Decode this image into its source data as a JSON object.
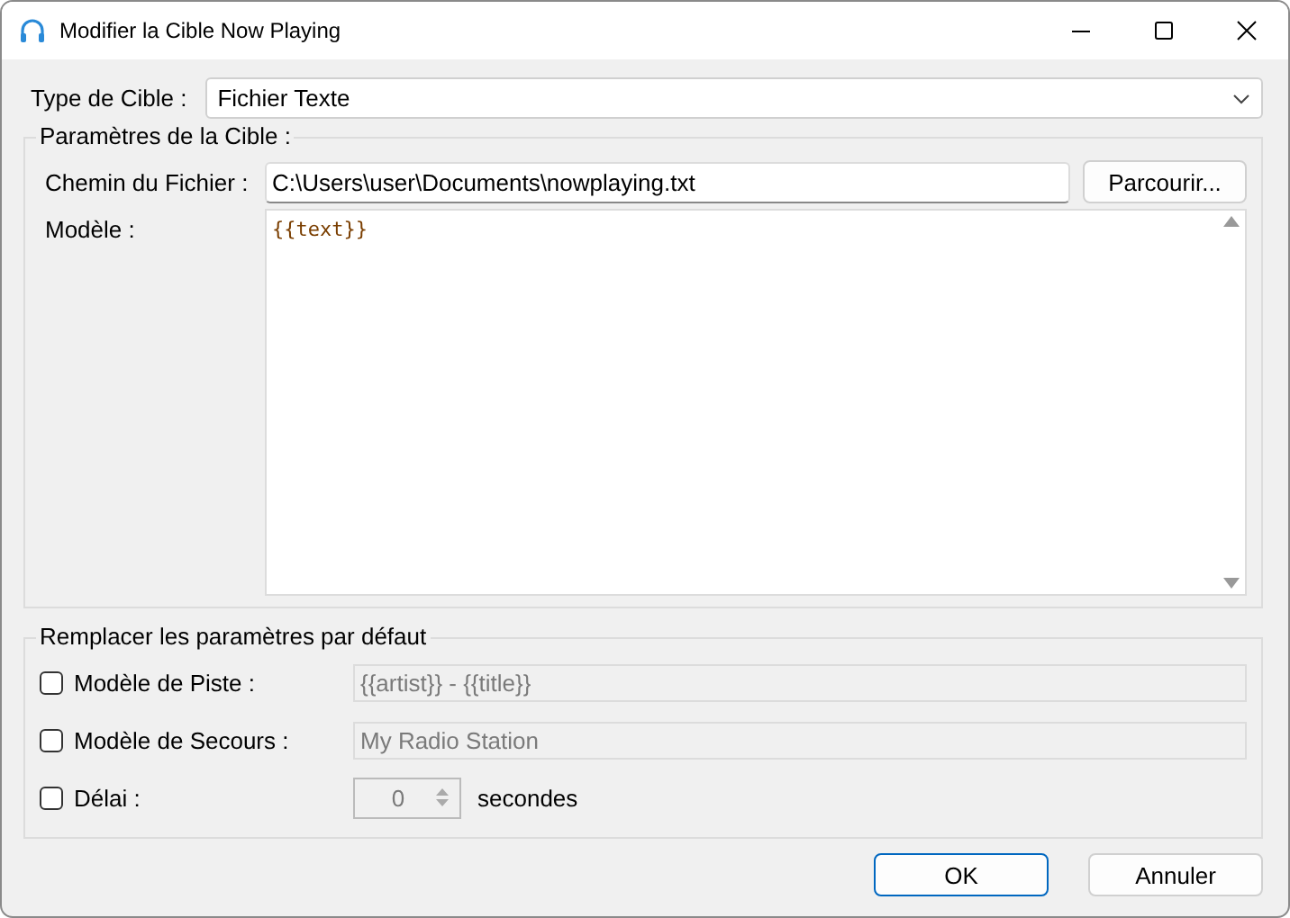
{
  "window": {
    "title": "Modifier la Cible Now Playing"
  },
  "target_type": {
    "label": "Type de Cible :",
    "value": "Fichier Texte"
  },
  "target_settings": {
    "title": "Paramètres de la Cible :",
    "file_path": {
      "label": "Chemin du Fichier :",
      "value": "C:\\Users\\user\\Documents\\nowplaying.txt",
      "button": "Parcourir..."
    },
    "template": {
      "label": "Modèle :",
      "value": "{{text}}"
    }
  },
  "overrides": {
    "title": "Remplacer les paramètres par défaut",
    "items": [
      {
        "kind": "text",
        "label": "Modèle de Piste :",
        "checked": false,
        "value": "{{artist}} - {{title}}"
      },
      {
        "kind": "text",
        "label": "Modèle de Secours :",
        "checked": false,
        "value": "My Radio Station"
      },
      {
        "kind": "number",
        "label": "Délai :",
        "checked": false,
        "value": "0",
        "unit": "secondes"
      }
    ]
  },
  "buttons": [
    {
      "label": "OK",
      "default": true
    },
    {
      "label": "Annuler",
      "default": false
    }
  ]
}
